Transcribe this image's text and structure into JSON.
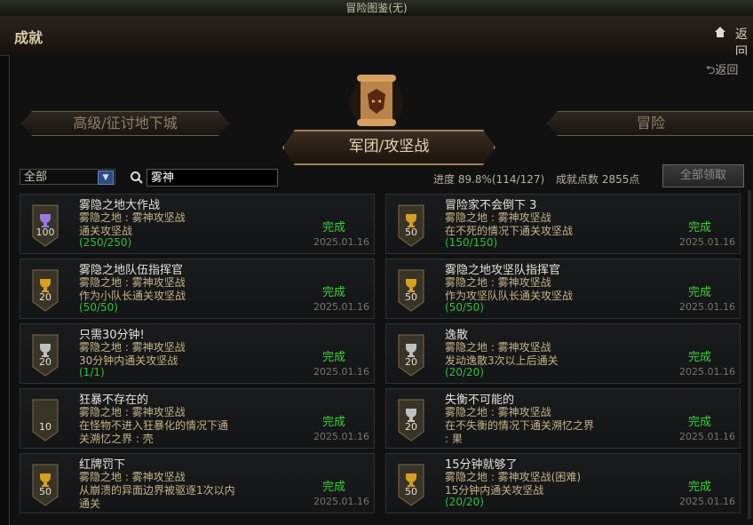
{
  "window": {
    "title": "冒险图鉴(无)"
  },
  "header": {
    "title": "成就",
    "back_label": "返回"
  },
  "panel": {
    "back_label": "返回"
  },
  "tabs": {
    "left": "高级/征讨地下城",
    "center": "军团/攻坚战",
    "right": "冒险"
  },
  "filter": {
    "selected": "全部",
    "search_value": "雾神"
  },
  "stats": {
    "progress": "进度 89.8%(114/127)",
    "points": "成就点数 2855点"
  },
  "buttons": {
    "claim_all": "全部领取"
  },
  "colors": {
    "complete": "#3ccf3c",
    "progress": "#2fbf3a",
    "accent": "#a08055"
  },
  "achievements": [
    {
      "name": "雾隐之地大作战",
      "line1": "雾隐之地 : 雾神攻坚战",
      "line2": "通关攻坚战",
      "line3": "",
      "progress": "(250/250)",
      "points": "100",
      "trophy": "purple",
      "status": "完成",
      "date": "2025.01.16"
    },
    {
      "name": "冒险家不会倒下 3",
      "line1": "雾隐之地 : 雾神攻坚战",
      "line2": "在不死的情况下通关攻坚战",
      "line3": "",
      "progress": "(150/150)",
      "points": "50",
      "trophy": "gold",
      "status": "完成",
      "date": "2025.01.16"
    },
    {
      "name": "雾隐之地队伍指挥官",
      "line1": "雾隐之地 : 雾神攻坚战",
      "line2": "作为小队长通关攻坚战",
      "line3": "",
      "progress": "(50/50)",
      "points": "20",
      "trophy": "gold",
      "status": "完成",
      "date": "2025.01.16"
    },
    {
      "name": "雾隐之地攻坚队指挥官",
      "line1": "雾隐之地 : 雾神攻坚战",
      "line2": "作为攻坚队队长通关攻坚战",
      "line3": "",
      "progress": "(50/50)",
      "points": "50",
      "trophy": "gold",
      "status": "完成",
      "date": "2025.01.16"
    },
    {
      "name": "只需30分钟!",
      "line1": "雾隐之地 : 雾神攻坚战",
      "line2": "30分钟内通关攻坚战",
      "line3": "",
      "progress": "(1/1)",
      "points": "20",
      "trophy": "silver",
      "status": "完成",
      "date": "2025.01.16"
    },
    {
      "name": "逸散",
      "line1": "雾隐之地 : 雾神攻坚战",
      "line2": "发动逸散3次以上后通关",
      "line3": "",
      "progress": "(20/20)",
      "points": "20",
      "trophy": "silver",
      "status": "完成",
      "date": "2025.01.16"
    },
    {
      "name": "狂暴不存在的",
      "line1": "雾隐之地 : 雾神攻坚战",
      "line2": "在怪物不进入狂暴化的情况下通",
      "line3": "关溯忆之界 : 壳",
      "progress": "",
      "points": "10",
      "trophy": "none",
      "status": "完成",
      "date": "2025.01.16"
    },
    {
      "name": "失衡不可能的",
      "line1": "雾隐之地 : 雾神攻坚战",
      "line2": "在不失衡的情况下通关溯忆之界",
      "line3": " : 果",
      "progress": "",
      "points": "20",
      "trophy": "silver",
      "status": "完成",
      "date": "2025.01.16"
    },
    {
      "name": "红牌罚下",
      "line1": "雾隐之地 : 雾神攻坚战",
      "line2": "从崩溃的异面边界被驱逐1次以内",
      "line3": "通关",
      "progress": "",
      "points": "50",
      "trophy": "gold",
      "status": "完成",
      "date": "2025.01.16"
    },
    {
      "name": "15分钟就够了",
      "line1": "雾隐之地 : 雾神攻坚战(困难)",
      "line2": "15分钟内通关攻坚战",
      "line3": "",
      "progress": "(20/20)",
      "points": "50",
      "trophy": "gold",
      "status": "完成",
      "date": "2025.01.16"
    }
  ]
}
